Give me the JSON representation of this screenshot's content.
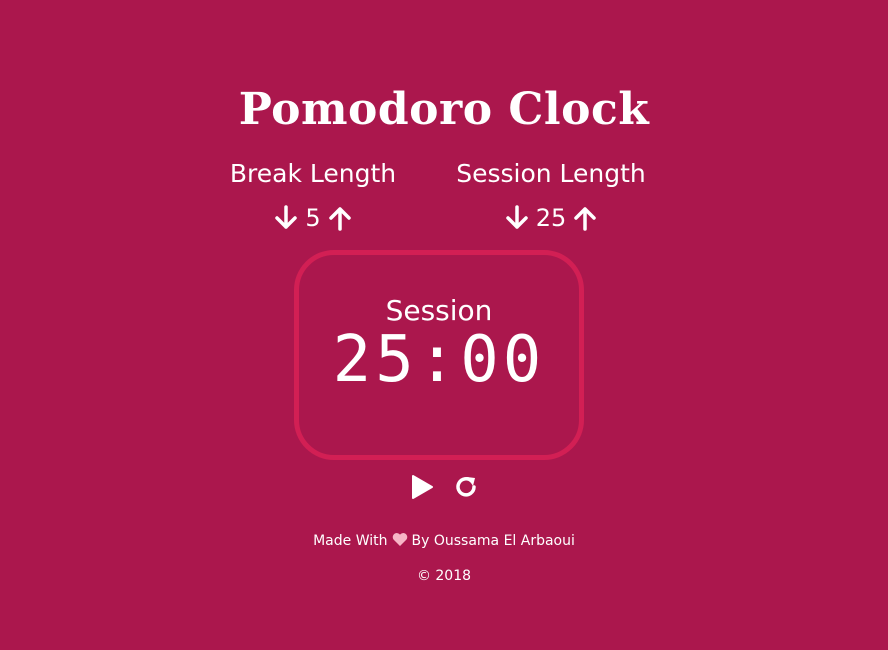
{
  "app": {
    "title": "Pomodoro Clock"
  },
  "break": {
    "label": "Break Length",
    "value": "5"
  },
  "session": {
    "label": "Session Length",
    "value": "25"
  },
  "timer": {
    "label": "Session",
    "time": "25:00"
  },
  "controls": {
    "play_icon": "play-icon",
    "reset_icon": "refresh-icon"
  },
  "footer": {
    "made_with": "Made With",
    "by": "By Oussama El Arbaoui",
    "copyright": "© 2018",
    "heart_color": "#f7b6c6"
  },
  "colors": {
    "background": "#ab174d",
    "accent_border": "#d21f54",
    "text": "#ffffff"
  }
}
